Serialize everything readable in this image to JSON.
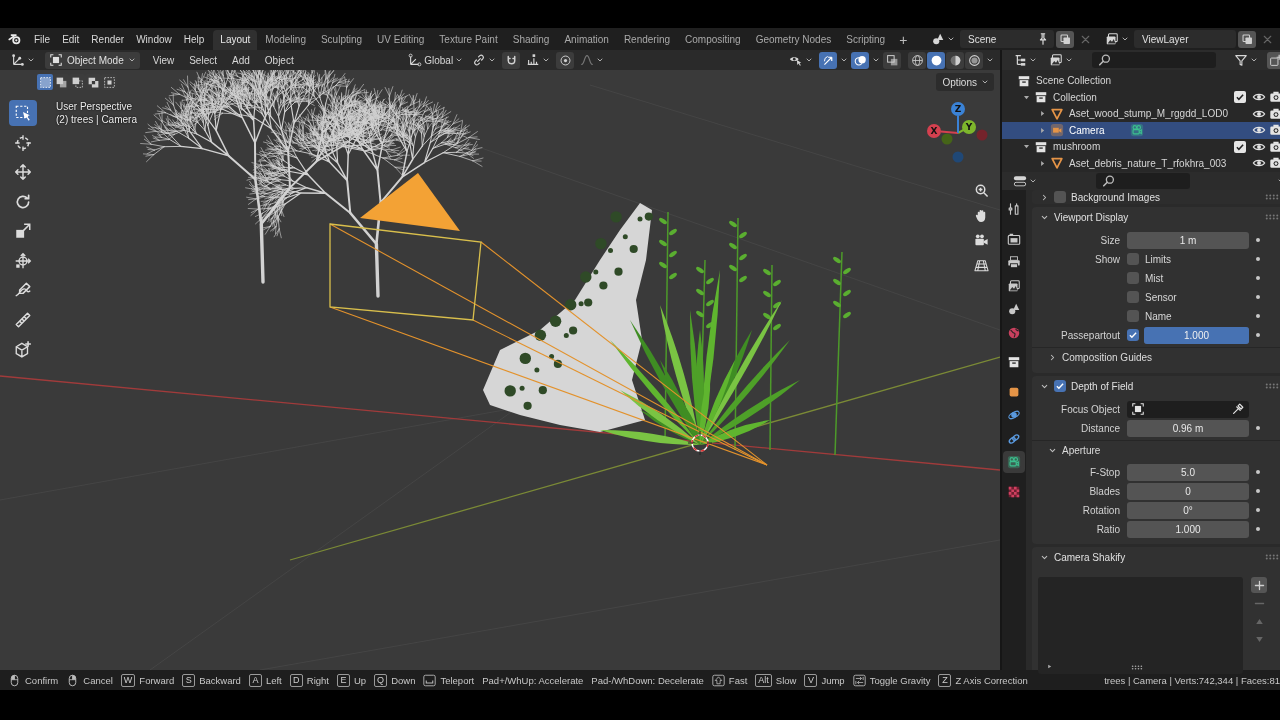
{
  "topbar": {
    "menus": [
      "File",
      "Edit",
      "Render",
      "Window",
      "Help"
    ],
    "workspaces": [
      {
        "label": "Layout",
        "selected": true
      },
      {
        "label": "Modeling",
        "selected": false
      },
      {
        "label": "Sculpting",
        "selected": false
      },
      {
        "label": "UV Editing",
        "selected": false
      },
      {
        "label": "Texture Paint",
        "selected": false
      },
      {
        "label": "Shading",
        "selected": false
      },
      {
        "label": "Animation",
        "selected": false
      },
      {
        "label": "Rendering",
        "selected": false
      },
      {
        "label": "Compositing",
        "selected": false
      },
      {
        "label": "Geometry Nodes",
        "selected": false
      },
      {
        "label": "Scripting",
        "selected": false
      }
    ],
    "add_workspace": "+",
    "scene": "Scene",
    "view_layer": "ViewLayer"
  },
  "viewport": {
    "header": {
      "mode": "Object Mode",
      "menus": [
        "View",
        "Select",
        "Add",
        "Object"
      ],
      "orientation": "Global",
      "snapping": {
        "on": false
      },
      "proportional_editing": {
        "on": false
      },
      "gizmos": {
        "on": true
      },
      "overlays": {
        "on": true
      },
      "xray": {
        "on": false
      },
      "shading": [
        {
          "kind": "wireframe",
          "selected": false
        },
        {
          "kind": "solid",
          "selected": true
        },
        {
          "kind": "material",
          "selected": false
        },
        {
          "kind": "rendered",
          "selected": false
        }
      ]
    },
    "select_modes": [
      {
        "kind": "set",
        "selected": true
      },
      {
        "kind": "extend",
        "selected": false
      },
      {
        "kind": "subtract",
        "selected": false
      },
      {
        "kind": "difference",
        "selected": false
      },
      {
        "kind": "intersect",
        "selected": false
      }
    ],
    "options": "Options",
    "info": [
      "User Perspective",
      "(2) trees | Camera"
    ],
    "tools": [
      {
        "kind": "select_box",
        "selected": true
      },
      {
        "kind": "cursor",
        "selected": false
      },
      {
        "kind": "move",
        "selected": false
      },
      {
        "kind": "rotate",
        "selected": false
      },
      {
        "kind": "scale",
        "selected": false
      },
      {
        "kind": "transform",
        "selected": false
      },
      {
        "kind": "annotate",
        "selected": false
      },
      {
        "kind": "measure",
        "selected": false
      },
      {
        "kind": "add_cube",
        "selected": false
      }
    ],
    "gizmo_axes": [
      {
        "label": "X",
        "color": "#d4404f"
      },
      {
        "label": "Y",
        "color": "#7db62c"
      },
      {
        "label": "Z",
        "color": "#3a82d6"
      }
    ]
  },
  "outliner": {
    "root": "Scene Collection",
    "items": [
      {
        "kind": "collection",
        "label": "Collection",
        "expanded": true,
        "selected": false,
        "checked": true,
        "children": [
          {
            "kind": "mesh",
            "label": "Aset_wood_stump_M_rggdd_LOD0",
            "expanded": false,
            "selected": false
          },
          {
            "kind": "camera",
            "label": "Camera",
            "expanded": false,
            "selected": true
          }
        ]
      },
      {
        "kind": "collection",
        "label": "mushroom",
        "expanded": true,
        "selected": false,
        "checked": true,
        "children": [
          {
            "kind": "mesh",
            "label": "Aset_debris_nature_T_rfokhra_003",
            "expanded": false,
            "selected": false
          }
        ]
      }
    ]
  },
  "properties": {
    "tabs": [
      {
        "kind": "tool",
        "selected": false
      },
      {
        "kind": "render",
        "selected": false
      },
      {
        "kind": "output",
        "selected": false
      },
      {
        "kind": "view_layer",
        "selected": false
      },
      {
        "kind": "scene",
        "selected": false
      },
      {
        "kind": "world",
        "selected": false
      },
      {
        "kind": "collection",
        "selected": false
      },
      {
        "kind": "object",
        "selected": false
      },
      {
        "kind": "physics",
        "selected": false
      },
      {
        "kind": "constraints",
        "selected": false
      },
      {
        "kind": "camera_data",
        "selected": true
      },
      {
        "kind": "texture",
        "selected": false
      }
    ],
    "panels": [
      {
        "kind": "toggle",
        "label": "Background Images",
        "expanded": false,
        "checked": false
      },
      {
        "kind": "plain",
        "label": "Viewport Display",
        "expanded": true,
        "rows": [
          {
            "kind": "number",
            "label": "Size",
            "value": "1 m"
          },
          {
            "kind": "checkbox",
            "label": "Show",
            "option": "Limits",
            "checked": false
          },
          {
            "kind": "checkbox",
            "option": "Mist",
            "checked": false
          },
          {
            "kind": "checkbox",
            "option": "Sensor",
            "checked": false
          },
          {
            "kind": "checkbox",
            "option": "Name",
            "checked": false
          },
          {
            "kind": "slider",
            "label": "Passepartout",
            "checked": true,
            "value": "1.000",
            "level": 1
          },
          {
            "kind": "subpanel",
            "label": "Composition Guides",
            "expanded": false
          }
        ]
      },
      {
        "kind": "toggle",
        "label": "Depth of Field",
        "expanded": true,
        "checked": true,
        "rows": [
          {
            "kind": "object",
            "label": "Focus Object"
          },
          {
            "kind": "number",
            "label": "Distance",
            "value": "0.96 m"
          },
          {
            "kind": "subpanel",
            "label": "Aperture",
            "expanded": true,
            "rows": [
              {
                "kind": "number",
                "label": "F-Stop",
                "value": "5.0"
              },
              {
                "kind": "number",
                "label": "Blades",
                "value": "0"
              },
              {
                "kind": "number",
                "label": "Rotation",
                "value": "0°"
              },
              {
                "kind": "number",
                "label": "Ratio",
                "value": "1.000"
              }
            ]
          }
        ]
      },
      {
        "kind": "plain",
        "label": "Camera Shakify",
        "expanded": true,
        "rows": [
          {
            "kind": "list"
          }
        ]
      }
    ]
  },
  "status_bar": {
    "hints": [
      {
        "kind": "mouse_left",
        "label": "Confirm"
      },
      {
        "kind": "mouse_right",
        "label": "Cancel"
      },
      {
        "kind": "key",
        "key": "W",
        "label": "Forward"
      },
      {
        "kind": "key",
        "key": "S",
        "label": "Backward"
      },
      {
        "kind": "key",
        "key": "A",
        "label": "Left"
      },
      {
        "kind": "key",
        "key": "D",
        "label": "Right"
      },
      {
        "kind": "key",
        "key": "E",
        "label": "Up"
      },
      {
        "kind": "key",
        "key": "Q",
        "label": "Down"
      },
      {
        "kind": "space",
        "label": "Teleport"
      },
      {
        "kind": "text",
        "label": "Pad+/WhUp: Accelerate"
      },
      {
        "kind": "text",
        "label": "Pad-/WhDown: Decelerate"
      },
      {
        "kind": "shift",
        "label": "Fast"
      },
      {
        "kind": "key",
        "key": "Alt",
        "label": "Slow"
      },
      {
        "kind": "key",
        "key": "V",
        "label": "Jump"
      },
      {
        "kind": "tab",
        "label": "Toggle Gravity"
      },
      {
        "kind": "key",
        "key": "Z",
        "label": "Z Axis Correction"
      }
    ],
    "stats": "trees | Camera | Verts:742,344 | Faces:81"
  }
}
